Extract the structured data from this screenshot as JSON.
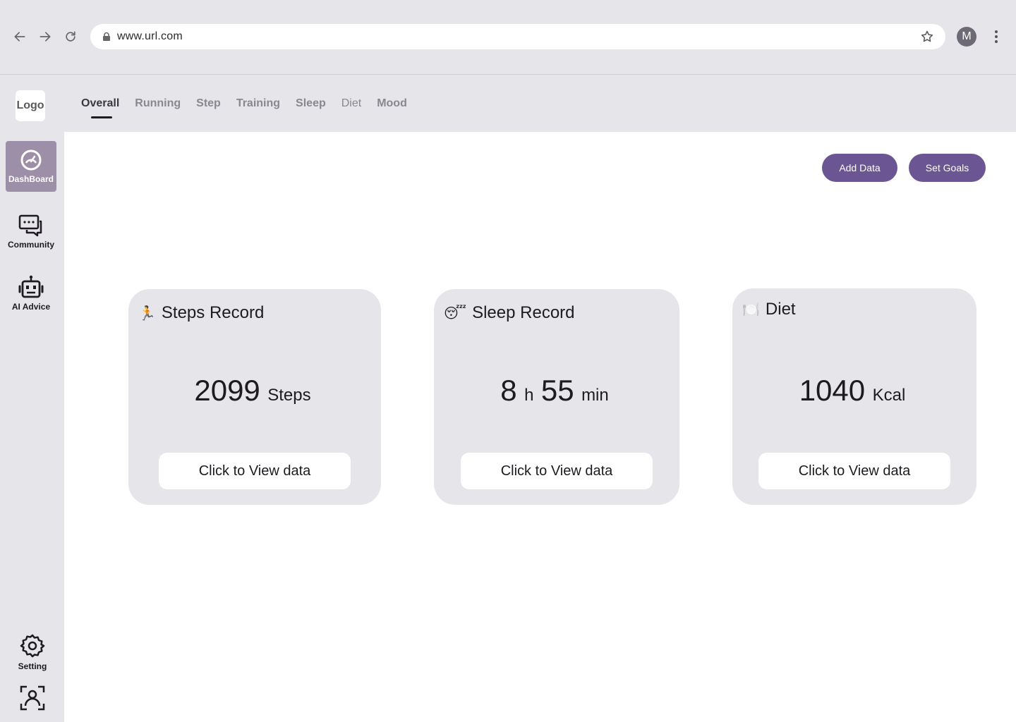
{
  "browser": {
    "url": "www.url.com",
    "profile_initial": "M"
  },
  "app": {
    "logo_text": "Logo",
    "tabs": [
      {
        "label": "Overall",
        "active": true
      },
      {
        "label": "Running"
      },
      {
        "label": "Step"
      },
      {
        "label": "Training"
      },
      {
        "label": "Sleep"
      },
      {
        "label": "Diet"
      },
      {
        "label": "Mood"
      }
    ]
  },
  "sidebar": {
    "items": [
      {
        "label": "DashBoard",
        "icon": "dashboard-gauge-icon",
        "active": true
      },
      {
        "label": "Community",
        "icon": "chat-bubbles-icon"
      },
      {
        "label": "AI Advice",
        "icon": "robot-icon"
      },
      {
        "label": "Setting",
        "icon": "gear-icon"
      },
      {
        "label": "",
        "icon": "profile-scan-icon"
      }
    ]
  },
  "actions": {
    "add_data": "Add Data",
    "set_goals": "Set Goals"
  },
  "cards": [
    {
      "emoji": "🏃",
      "title": "Steps Record",
      "parts": [
        {
          "num": "2099"
        },
        {
          "unit": "Steps"
        }
      ],
      "button": "Click to View data"
    },
    {
      "emoji": "😴",
      "title": "Sleep Record",
      "parts": [
        {
          "num": "8"
        },
        {
          "unit": "h"
        },
        {
          "num": "55"
        },
        {
          "unit": "min"
        }
      ],
      "button": "Click to View data"
    },
    {
      "emoji": "🍽️",
      "title": "Diet",
      "parts": [
        {
          "num": "1040"
        },
        {
          "unit": "Kcal"
        }
      ],
      "button": "Click to View data"
    }
  ],
  "colors": {
    "accent": "#6b5592",
    "sidebar_active": "#9e8fa8",
    "card_bg": "#e6e5ea"
  }
}
